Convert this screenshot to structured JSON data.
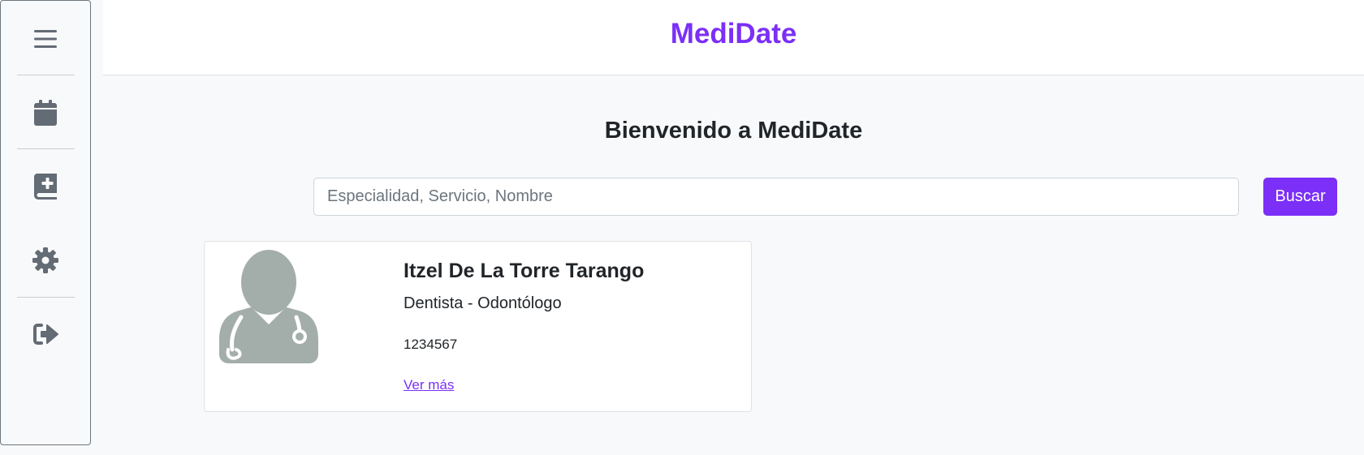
{
  "sidebar": {
    "items": [
      {
        "name": "menu",
        "icon": "hamburger-menu-icon"
      },
      {
        "name": "calendar",
        "icon": "calendar-icon"
      },
      {
        "name": "medical-book",
        "icon": "medical-book-icon"
      },
      {
        "name": "settings",
        "icon": "gear-icon"
      },
      {
        "name": "logout",
        "icon": "logout-icon"
      }
    ]
  },
  "header": {
    "brand": "MediDate"
  },
  "main": {
    "welcome": "Bienvenido a MediDate",
    "search": {
      "placeholder": "Especialidad, Servicio, Nombre",
      "value": "",
      "button_label": "Buscar"
    },
    "doctors": [
      {
        "avatar_icon": "doctor-avatar-icon",
        "name": "Itzel De La Torre Tarango",
        "specialty": "Dentista - Odontólogo",
        "phone": "1234567",
        "link_label": "Ver más"
      }
    ]
  },
  "colors": {
    "accent": "#7b2ff7",
    "icon_gray": "#636b75",
    "avatar_gray": "#a3aeab",
    "background": "#f8f9fa"
  }
}
